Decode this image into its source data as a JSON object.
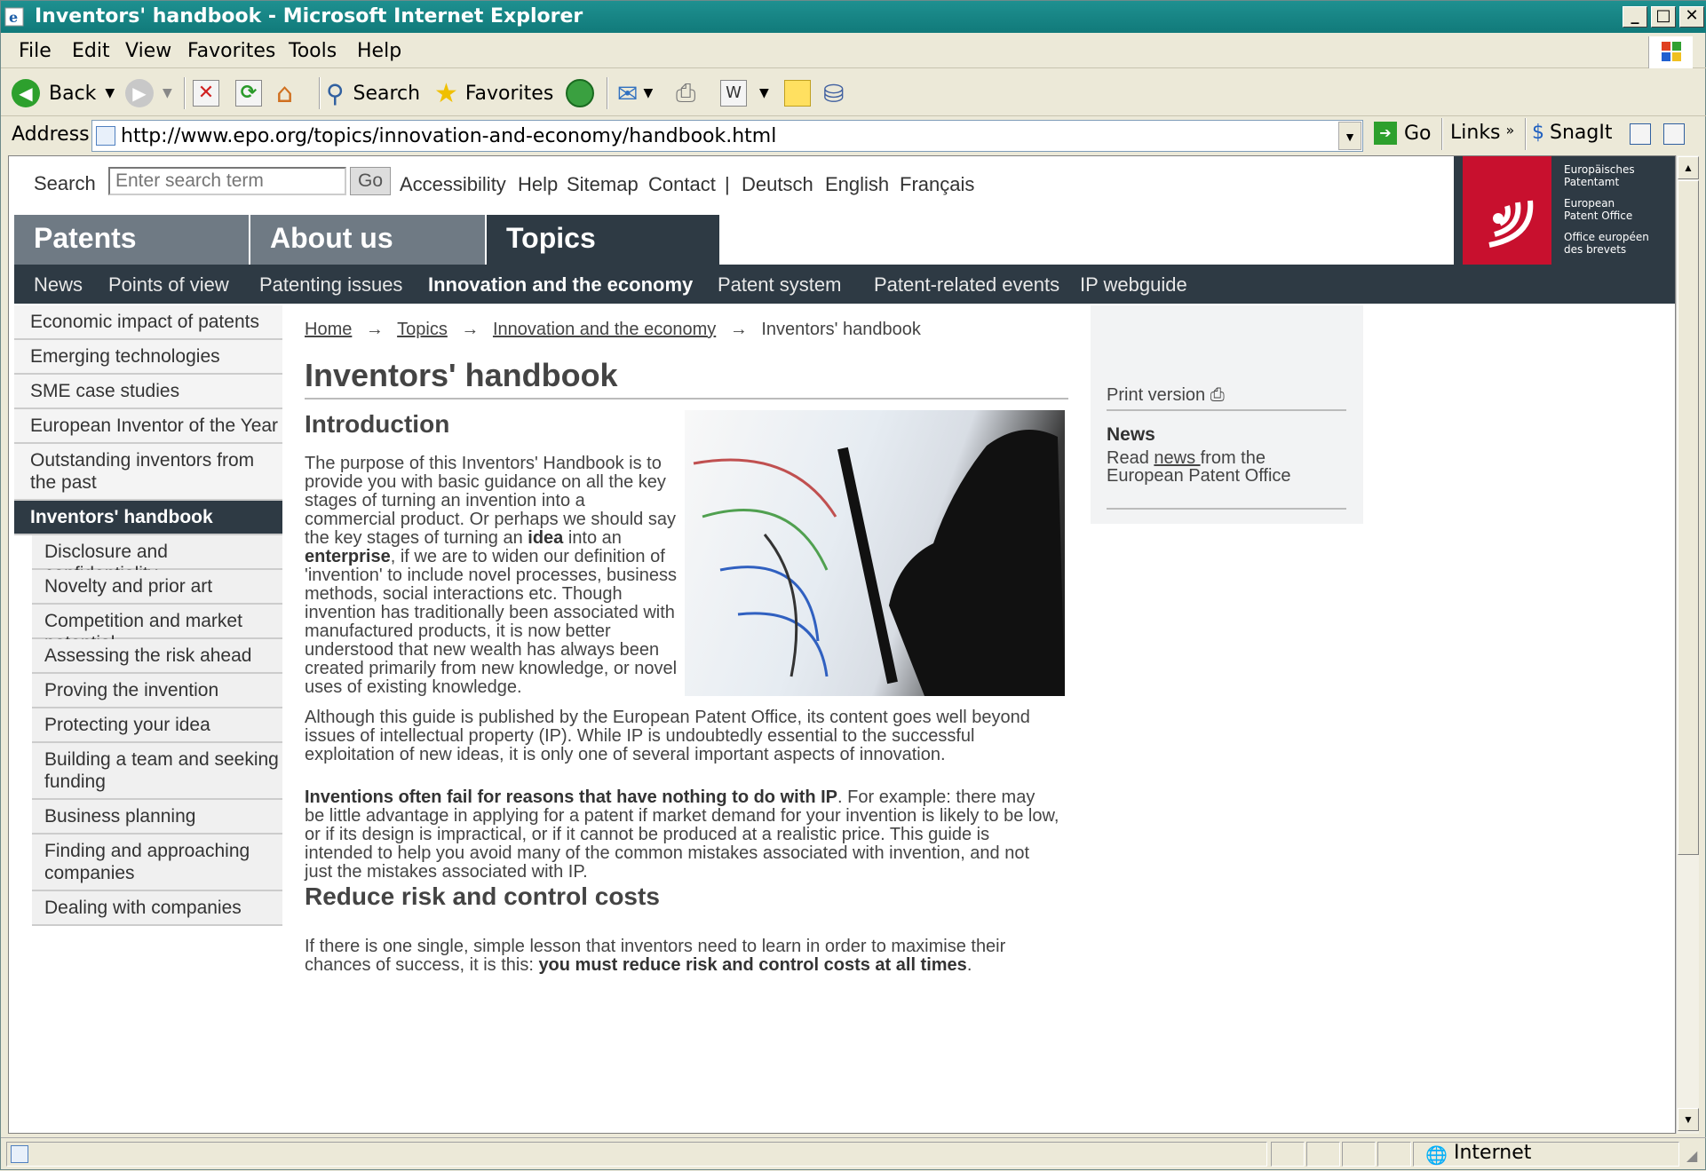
{
  "window": {
    "title": "Inventors' handbook - Microsoft Internet Explorer"
  },
  "menu": [
    "File",
    "Edit",
    "View",
    "Favorites",
    "Tools",
    "Help"
  ],
  "toolbar": {
    "back": "Back",
    "search": "Search",
    "favorites": "Favorites"
  },
  "address": {
    "label": "Address",
    "url": "http://www.epo.org/topics/innovation-and-economy/handbook.html",
    "go": "Go",
    "links": "Links",
    "snagit": "SnagIt"
  },
  "header": {
    "search_label": "Search",
    "search_placeholder": "Enter search term",
    "go": "Go",
    "links": [
      "Accessibility",
      "Help",
      "Sitemap",
      "Contact",
      "|",
      "Deutsch",
      "English",
      "Français"
    ],
    "logo_lines": [
      "Europäisches",
      "Patentamt",
      "European",
      "Patent Office",
      "Office européen",
      "des brevets"
    ]
  },
  "main_tabs": [
    "Patents",
    "About us",
    "Topics"
  ],
  "subnav": [
    "News",
    "Points of view",
    "Patenting issues",
    "Innovation and the economy",
    "Patent system",
    "Patent-related events",
    "IP webguide"
  ],
  "sidebar": {
    "items": [
      "Economic impact of patents",
      "Emerging technologies",
      "SME case studies",
      "European Inventor of the Year",
      "Outstanding inventors from the past",
      "Inventors' handbook",
      "Disclosure and confidentiality",
      "Novelty and prior art",
      "Competition and market potential",
      "Assessing the risk ahead",
      "Proving the invention",
      "Protecting your idea",
      "Building a team and seeking funding",
      "Business planning",
      "Finding and approaching companies",
      "Dealing with companies"
    ]
  },
  "breadcrumb": {
    "items": [
      "Home",
      "Topics",
      "Innovation and the economy",
      "Inventors' handbook"
    ],
    "arrow": "→"
  },
  "content": {
    "title": "Inventors' handbook",
    "intro_heading": "Introduction",
    "p1_a": "The purpose of this Inventors' Handbook is to provide you with basic guidance on all the key stages of turning an invention into a commercial product. Or perhaps we should say the key stages of turning an ",
    "p1_b": "idea",
    "p1_c": " into an ",
    "p1_d": "enterprise",
    "p1_e": ", if we are to widen our definition of 'invention' to include novel processes, business methods, social interactions etc. Though invention has traditionally been associated with manufactured products, it is now better understood that new wealth has always been created primarily from new knowledge, or novel uses of existing knowledge.",
    "p2": "Although this guide is published by the European Patent Office, its content goes well beyond issues of intellectual property (IP). While IP is undoubtedly essential to the successful exploitation of new ideas, it is only one of several important aspects of innovation.",
    "p3_bold": "Inventions often fail for reasons that have nothing to do with IP",
    "p3_rest": ". For example: there may be little advantage in applying for a patent if market demand for your invention is likely to be low, or if its design is impractical, or if it cannot be produced at a realistic price. This guide is intended to help you avoid many of the common mistakes associated with invention, and not just the mistakes associated with IP.",
    "h2_risk": "Reduce risk and control costs",
    "p4_a": "If there is one single, simple lesson that inventors need to learn in order to maximise their chances of success, it is this: ",
    "p4_b": "you must reduce risk and control costs at all times",
    "p4_c": "."
  },
  "right": {
    "print": "Print version",
    "news_heading": "News",
    "news_a": "Read ",
    "news_link": "news ",
    "news_b": "from the European Patent Office"
  },
  "status": {
    "zone": "Internet"
  },
  "colors": {
    "teal_title": "#117a7a",
    "nav_dark": "#2e3a44",
    "tab_grey": "#6f7a84",
    "epo_red": "#c8102e"
  }
}
